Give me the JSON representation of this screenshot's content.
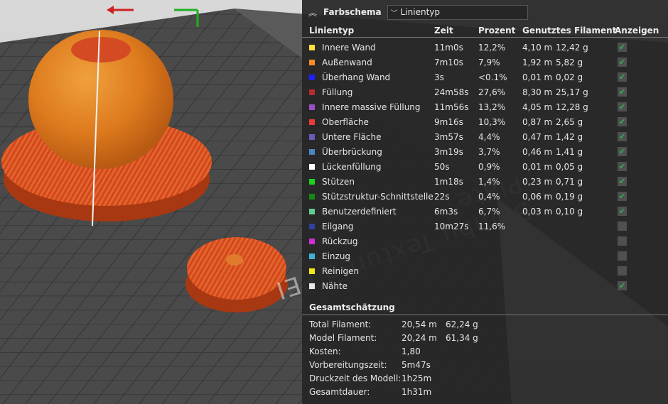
{
  "scene": {
    "plate_text": "Bambu Textured PEI Plate"
  },
  "panel": {
    "header": {
      "collapse_icon": "chevron-up-double-icon",
      "title": "Farbschema",
      "select_value": "Linientyp"
    },
    "columns": {
      "name": "Linientyp",
      "time": "Zeit",
      "pct": "Prozent",
      "filament": "Genutztes Filament",
      "show": "Anzeigen"
    },
    "rows": [
      {
        "name": "Innere Wand",
        "color": "#ffe13a",
        "time": "11m0s",
        "pct": "12,2%",
        "len": "4,10 m",
        "wgt": "12,42 g",
        "checked": true
      },
      {
        "name": "Außenwand",
        "color": "#ff8c29",
        "time": "7m10s",
        "pct": "7,9%",
        "len": "1,92 m",
        "wgt": "5,82 g",
        "checked": true
      },
      {
        "name": "Überhang Wand",
        "color": "#1e1eff",
        "time": "3s",
        "pct": "<0.1%",
        "len": "0,01 m",
        "wgt": "0,02 g",
        "checked": true
      },
      {
        "name": "Füllung",
        "color": "#b52d2d",
        "time": "24m58s",
        "pct": "27,6%",
        "len": "8,30 m",
        "wgt": "25,17 g",
        "checked": true
      },
      {
        "name": "Innere massive Füllung",
        "color": "#9a4fc6",
        "time": "11m56s",
        "pct": "13,2%",
        "len": "4,05 m",
        "wgt": "12,28 g",
        "checked": true
      },
      {
        "name": "Oberfläche",
        "color": "#ef3a3a",
        "time": "9m16s",
        "pct": "10,3%",
        "len": "0,87 m",
        "wgt": "2,65 g",
        "checked": true
      },
      {
        "name": "Untere Fläche",
        "color": "#6e58b8",
        "time": "3m57s",
        "pct": "4,4%",
        "len": "0,47 m",
        "wgt": "1,42 g",
        "checked": true
      },
      {
        "name": "Überbrückung",
        "color": "#4d84c4",
        "time": "3m19s",
        "pct": "3,7%",
        "len": "0,46 m",
        "wgt": "1,41 g",
        "checked": true
      },
      {
        "name": "Lückenfüllung",
        "color": "#ffffff",
        "time": "50s",
        "pct": "0,9%",
        "len": "0,01 m",
        "wgt": "0,05 g",
        "checked": true
      },
      {
        "name": "Stützen",
        "color": "#1fd21f",
        "time": "1m18s",
        "pct": "1,4%",
        "len": "0,23 m",
        "wgt": "0,71 g",
        "checked": true
      },
      {
        "name": "Stützstruktur-Schnittstelle",
        "color": "#138a13",
        "time": "22s",
        "pct": "0,4%",
        "len": "0,06 m",
        "wgt": "0,19 g",
        "checked": true
      },
      {
        "name": "Benutzerdefiniert",
        "color": "#5fcf8f",
        "time": "6m3s",
        "pct": "6,7%",
        "len": "0,03 m",
        "wgt": "0,10 g",
        "checked": true
      },
      {
        "name": "Eilgang",
        "color": "#3240a0",
        "time": "10m27s",
        "pct": "11,6%",
        "len": "",
        "wgt": "",
        "checked": false
      },
      {
        "name": "Rückzug",
        "color": "#d42fd4",
        "time": "",
        "pct": "",
        "len": "",
        "wgt": "",
        "checked": false
      },
      {
        "name": "Einzug",
        "color": "#3fb0d6",
        "time": "",
        "pct": "",
        "len": "",
        "wgt": "",
        "checked": false
      },
      {
        "name": "Reinigen",
        "color": "#f4e81a",
        "time": "",
        "pct": "",
        "len": "",
        "wgt": "",
        "checked": false
      },
      {
        "name": "Nähte",
        "color": "#e8e8e8",
        "time": "",
        "pct": "",
        "len": "",
        "wgt": "",
        "checked": true
      }
    ],
    "summary": {
      "title": "Gesamtschätzung",
      "rows": [
        {
          "label": "Total Filament:",
          "v1": "20,54 m",
          "v2": "62,24 g"
        },
        {
          "label": "Model Filament:",
          "v1": "20,24 m",
          "v2": "61,34 g"
        },
        {
          "label": "Kosten:",
          "v1": "1,80",
          "v2": ""
        },
        {
          "label": "Vorbereitungszeit:",
          "v1": "5m47s",
          "v2": ""
        },
        {
          "label": "Druckzeit des Modell:",
          "v1": "1h25m",
          "v2": ""
        },
        {
          "label": "Gesamtdauer:",
          "v1": "1h31m",
          "v2": ""
        }
      ]
    }
  }
}
